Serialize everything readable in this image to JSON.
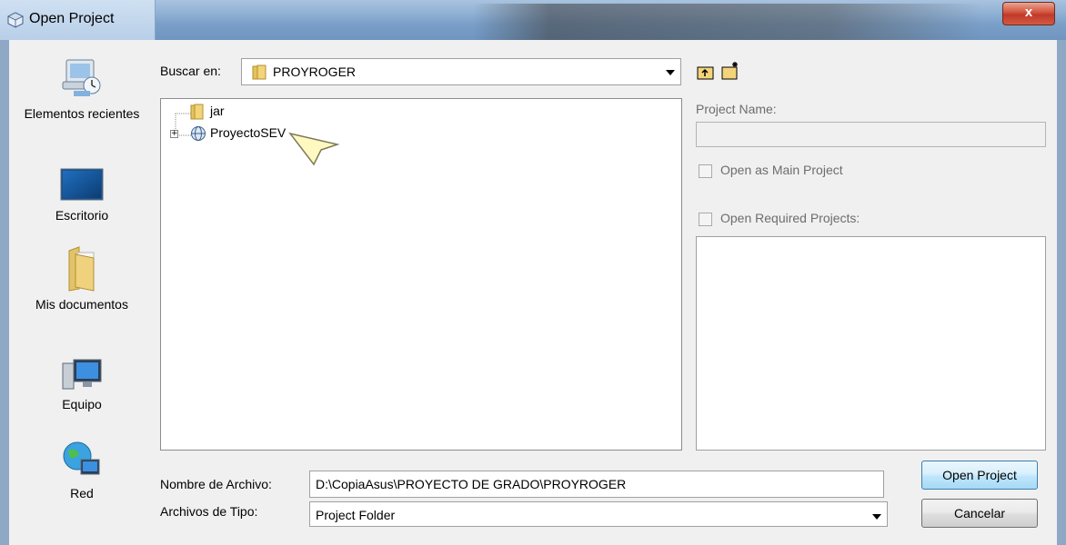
{
  "window": {
    "title": "Open Project",
    "close_label": "x"
  },
  "places": [
    {
      "label": "Elementos recientes",
      "icon": "recent-items-icon"
    },
    {
      "label": "Escritorio",
      "icon": "desktop-icon"
    },
    {
      "label": "Mis documentos",
      "icon": "my-documents-icon"
    },
    {
      "label": "Equipo",
      "icon": "computer-icon"
    },
    {
      "label": "Red",
      "icon": "network-icon"
    }
  ],
  "lookin": {
    "label": "Buscar en:",
    "value": "PROYROGER"
  },
  "tree": [
    {
      "label": "jar",
      "icon": "folder-icon"
    },
    {
      "label": "ProyectoSEV",
      "icon": "web-project-icon",
      "expander": "+"
    }
  ],
  "project_panel": {
    "name_label": "Project Name:",
    "name_value": "",
    "open_main_label": "Open as Main Project",
    "open_required_label": "Open Required Projects:"
  },
  "filename": {
    "label": "Nombre de Archivo:",
    "value": "D:\\CopiaAsus\\PROYECTO DE GRADO\\PROYROGER"
  },
  "filetype": {
    "label": "Archivos de Tipo:",
    "value": "Project Folder"
  },
  "buttons": {
    "open": "Open Project",
    "cancel": "Cancelar"
  }
}
